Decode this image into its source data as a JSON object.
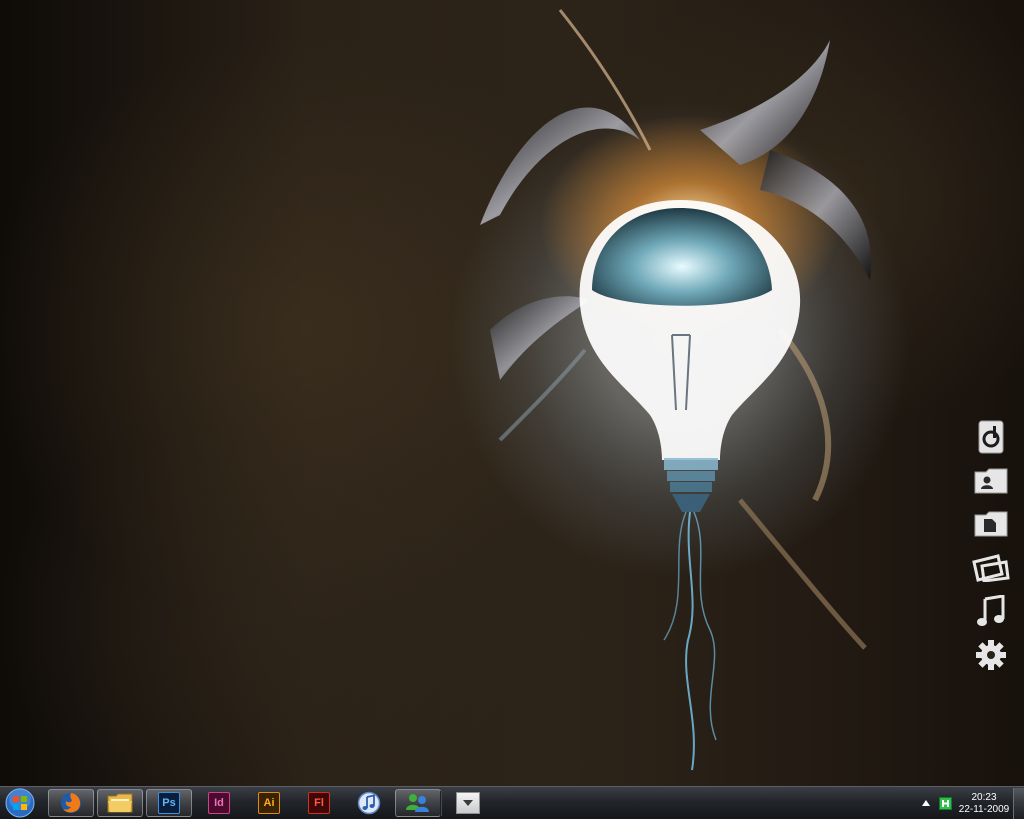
{
  "wallpaper": {
    "colors": {
      "background": "#2a2117",
      "glow": "#e8f4ff",
      "flare": "#ff9a2a",
      "electric": "#7fd4ff"
    }
  },
  "side_dock": {
    "items": [
      {
        "name": "media-player",
        "icon": "music-disc-icon"
      },
      {
        "name": "contacts",
        "icon": "contact-card-icon"
      },
      {
        "name": "documents",
        "icon": "document-icon"
      },
      {
        "name": "pictures",
        "icon": "pictures-icon"
      },
      {
        "name": "music",
        "icon": "music-note-icon"
      },
      {
        "name": "settings",
        "icon": "gear-icon"
      }
    ]
  },
  "taskbar": {
    "start_icon": "windows-orb-icon",
    "pinned": [
      {
        "name": "firefox",
        "icon": "firefox-icon",
        "active": true
      },
      {
        "name": "explorer",
        "icon": "folder-icon",
        "active": true
      },
      {
        "name": "photoshop",
        "label": "Ps",
        "color": "#3d8fe0",
        "active": true
      },
      {
        "name": "indesign",
        "label": "Id",
        "color": "#d04090",
        "active": false
      },
      {
        "name": "illustrator",
        "label": "Ai",
        "color": "#e08a10",
        "active": false
      },
      {
        "name": "flash",
        "label": "Fl",
        "color": "#d0301e",
        "active": false
      },
      {
        "name": "itunes",
        "icon": "itunes-icon",
        "active": false
      },
      {
        "name": "messenger",
        "icon": "messenger-icon",
        "active": true
      }
    ],
    "quick_menu_icon": "dropdown-triangle-icon"
  },
  "tray": {
    "expand_icon": "tray-up-arrow-icon",
    "app_icon": "tray-app-icon",
    "time": "20:23",
    "date": "22-11-2009"
  }
}
